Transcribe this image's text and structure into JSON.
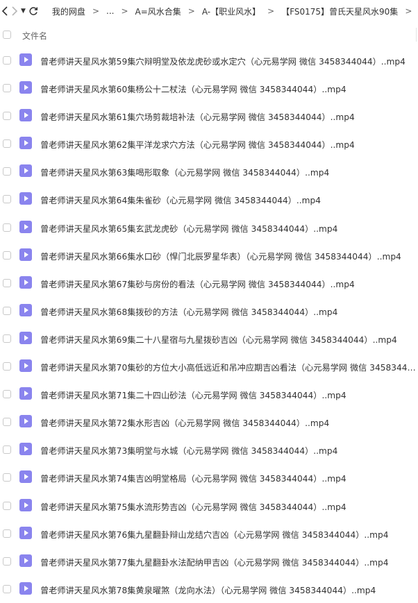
{
  "nav": {
    "dropdown_glyph": "▼",
    "back_icon": "chevron-left-icon",
    "forward_icon": "chevron-right-icon",
    "refresh_icon": "refresh-icon"
  },
  "breadcrumb": {
    "separator": ">",
    "items": [
      "我的网盘",
      "...",
      "A=风水合集",
      "A-【职业风水】",
      "【FS0175】曾氏天星风水90集",
      ""
    ]
  },
  "header": {
    "name_column": "文件名"
  },
  "colors": {
    "file_icon": "#8a84ee",
    "text": "#333333"
  },
  "files": [
    {
      "name": "曾老师讲天星风水第59集穴辩明堂及依龙虎砂或水定穴（心元易学网 微信 3458344044）..mp4"
    },
    {
      "name": "曾老师讲天星风水第60集杨公十二杖法（心元易学网 微信 3458344044）..mp4"
    },
    {
      "name": "曾老师讲天星风水第61集穴场剪裁培补法（心元易学网 微信 3458344044）..mp4"
    },
    {
      "name": "曾老师讲天星风水第62集平洋龙求穴方法（心元易学网 微信 3458344044）..mp4"
    },
    {
      "name": "曾老师讲天星风水第63集喝形取象（心元易学网 微信 3458344044）..mp4"
    },
    {
      "name": "曾老师讲天星风水第64集朱雀砂（心元易学网 微信 3458344044）..mp4"
    },
    {
      "name": "曾老师讲天星风水第65集玄武龙虎砂（心元易学网 微信 3458344044）..mp4"
    },
    {
      "name": "曾老师讲天星风水第66集水口砂（悍门北辰罗星华表）（心元易学网 微信 3458344044）..mp4"
    },
    {
      "name": "曾老师讲天星风水第67集砂与房份的看法（心元易学网 微信 3458344044）..mp4"
    },
    {
      "name": "曾老师讲天星风水第68集拨砂的方法（心元易学网 微信 3458344044）..mp4"
    },
    {
      "name": "曾老师讲天星风水第69集二十八星宿与九星拨砂吉凶（心元易学网 微信 3458344044）..mp4"
    },
    {
      "name": "曾老师讲天星风水第70集砂的方位大小高低远近和吊冲应期吉凶看法（心元易学网 微信 3458344044..."
    },
    {
      "name": "曾老师讲天星风水第71集二十四山砂法（心元易学网 微信 3458344044）..mp4"
    },
    {
      "name": "曾老师讲天星风水第72集水形吉凶（心元易学网 微信 3458344044）..mp4"
    },
    {
      "name": "曾老师讲天星风水第73集明堂与水城（心元易学网 微信 3458344044）..mp4"
    },
    {
      "name": "曾老师讲天星风水第74集吉凶明堂格局（心元易学网 微信 3458344044）..mp4"
    },
    {
      "name": "曾老师讲天星风水第75集水流形势吉凶（心元易学网 微信 3458344044）..mp4"
    },
    {
      "name": "曾老师讲天星风水第76集九星翻卦辩山龙结穴吉凶（心元易学网 微信 3458344044）..mp4"
    },
    {
      "name": "曾老师讲天星风水第77集九星翻卦水法配纳甲吉凶（心元易学网 微信 3458344044）..mp4"
    },
    {
      "name": "曾老师讲天星风水第78集黄泉曜煞（龙向水法）（心元易学网 微信 3458344044）..mp4"
    }
  ]
}
